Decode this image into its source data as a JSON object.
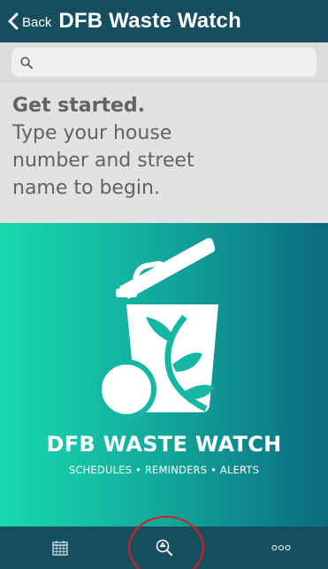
{
  "header": {
    "back_label": "Back",
    "title": "DFB Waste Watch",
    "back_icon": "chevron-left-icon"
  },
  "search": {
    "value": "",
    "placeholder": "",
    "icon": "search-icon"
  },
  "intro": {
    "heading": "Get started.",
    "body_lines": [
      "Type your house",
      "number and street",
      "name to begin."
    ]
  },
  "brand": {
    "name": "DFB WASTE WATCH",
    "tagline": "SCHEDULES • REMINDERS • ALERTS",
    "logo_icon": "waste-bin-logo-icon"
  },
  "tab_bar": {
    "tabs": [
      {
        "name": "calendar",
        "icon": "calendar-icon"
      },
      {
        "name": "find-address",
        "icon": "recycle-search-icon",
        "highlighted": true
      },
      {
        "name": "more",
        "icon": "more-dots-icon"
      }
    ]
  },
  "colors": {
    "nav": "#164d5f",
    "intro_bg": "#e2e2e2",
    "intro_text": "#636363",
    "gradient_start": "#18d9ae",
    "gradient_end": "#0b6b7d",
    "highlight": "#d81e1e"
  }
}
